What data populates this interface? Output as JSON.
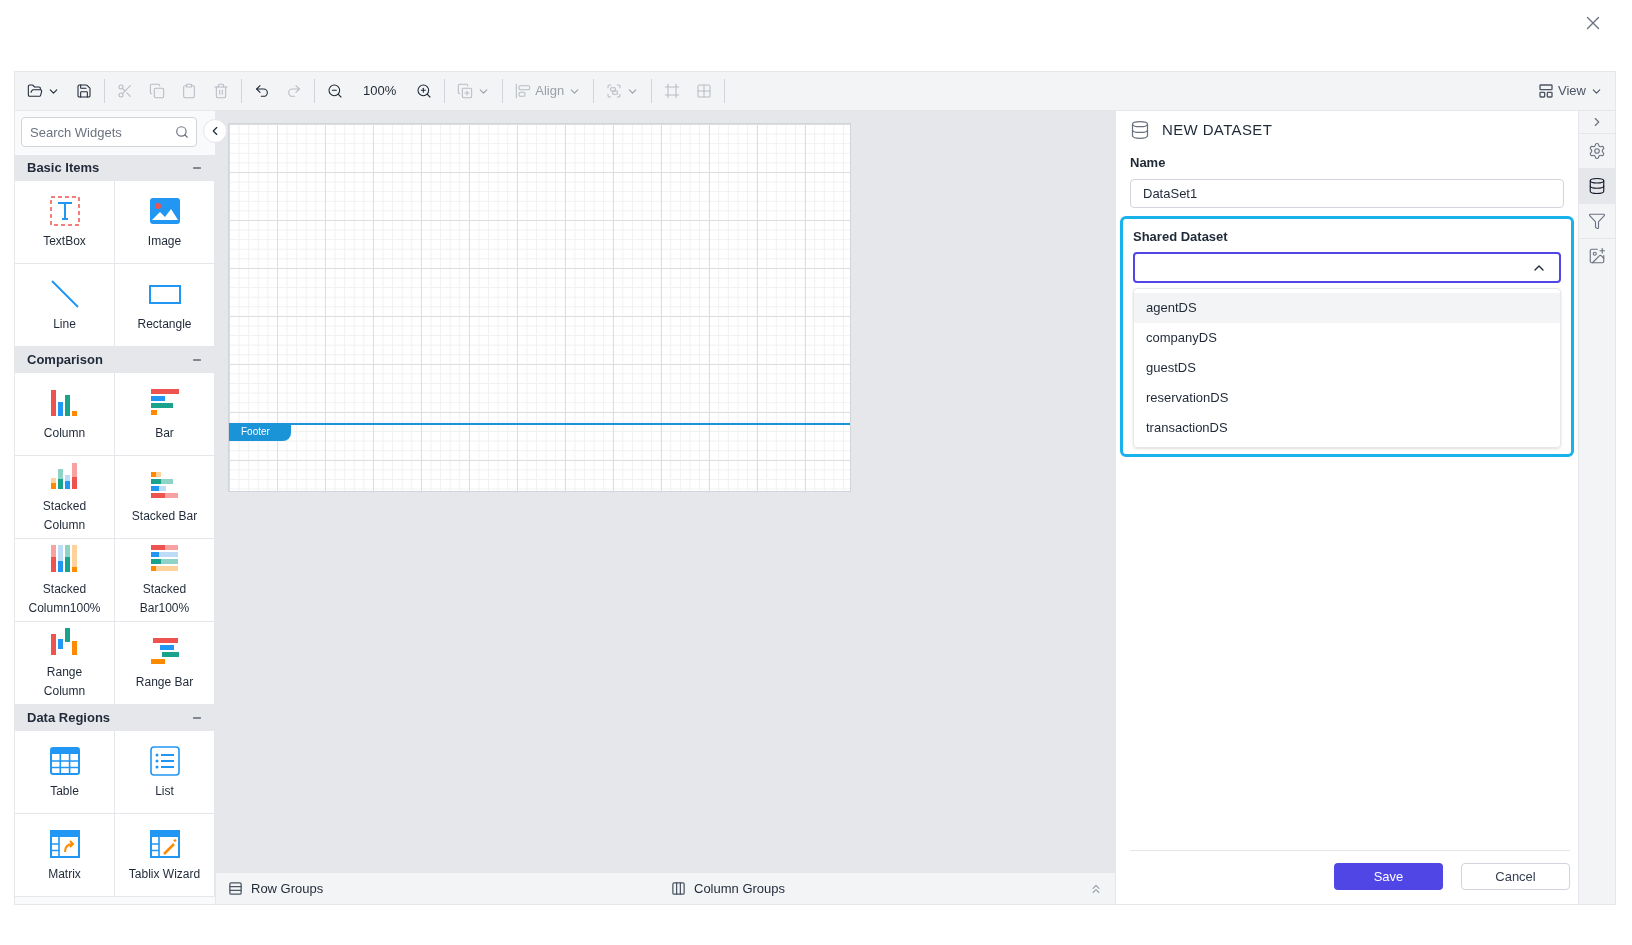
{
  "toolbar": [
    {
      "kind": "open",
      "disabled": false
    },
    {
      "kind": "save",
      "disabled": false
    },
    {
      "kind": "cut",
      "disabled": true
    },
    {
      "kind": "copy",
      "disabled": true
    },
    {
      "kind": "paste",
      "disabled": true
    },
    {
      "kind": "delete",
      "disabled": true
    },
    {
      "kind": "undo",
      "disabled": false
    },
    {
      "kind": "redo",
      "disabled": true
    },
    {
      "kind": "zoom-out",
      "disabled": false
    },
    {
      "kind": "zoom-level",
      "label": "100%",
      "disabled": false
    },
    {
      "kind": "zoom-in",
      "disabled": false
    },
    {
      "kind": "order",
      "disabled": true
    },
    {
      "kind": "align",
      "label": "Align",
      "disabled": true
    },
    {
      "kind": "group",
      "disabled": true
    },
    {
      "kind": "fit",
      "disabled": true
    },
    {
      "kind": "grid",
      "disabled": true
    }
  ],
  "view_menu": {
    "label": "View"
  },
  "search": {
    "placeholder": "Search Widgets"
  },
  "widget_groups": [
    {
      "title": "Basic Items",
      "items": [
        {
          "label": "TextBox",
          "kind": "textbox"
        },
        {
          "label": "Image",
          "kind": "image"
        },
        {
          "label": "Line",
          "kind": "line"
        },
        {
          "label": "Rectangle",
          "kind": "rectangle"
        }
      ]
    },
    {
      "title": "Comparison",
      "items": [
        {
          "label": "Column",
          "kind": "column"
        },
        {
          "label": "Bar",
          "kind": "bar"
        },
        {
          "label": "Stacked Column",
          "kind": "stacked-column"
        },
        {
          "label": "Stacked Bar",
          "kind": "stacked-bar"
        },
        {
          "label": "Stacked Column100%",
          "kind": "stacked-column-100"
        },
        {
          "label": "Stacked Bar100%",
          "kind": "stacked-bar-100"
        },
        {
          "label": "Range Column",
          "kind": "range-column"
        },
        {
          "label": "Range Bar",
          "kind": "range-bar"
        }
      ]
    },
    {
      "title": "Data Regions",
      "items": [
        {
          "label": "Table",
          "kind": "table"
        },
        {
          "label": "List",
          "kind": "list"
        },
        {
          "label": "Matrix",
          "kind": "matrix"
        },
        {
          "label": "Tablix Wizard",
          "kind": "tablix-wizard"
        }
      ]
    }
  ],
  "report": {
    "footer_label": "Footer"
  },
  "group_bar": {
    "row_groups": "Row Groups",
    "column_groups": "Column Groups"
  },
  "panel": {
    "title": "NEW DATASET",
    "name_label": "Name",
    "name_value": "DataSet1",
    "shared_label": "Shared Dataset",
    "dropdown_expanded": true,
    "options": [
      {
        "label": "agentDS",
        "selected": true
      },
      {
        "label": "companyDS",
        "selected": false
      },
      {
        "label": "guestDS",
        "selected": false
      },
      {
        "label": "reservationDS",
        "selected": false
      },
      {
        "label": "transactionDS",
        "selected": false
      }
    ],
    "buttons": [
      {
        "label": "Save",
        "kind": "primary"
      },
      {
        "label": "Cancel",
        "kind": "secondary"
      }
    ]
  },
  "side_tabs": [
    {
      "kind": "properties",
      "selected": false
    },
    {
      "kind": "data",
      "selected": true
    },
    {
      "kind": "filter",
      "selected": false
    },
    {
      "kind": "image-settings",
      "selected": false
    }
  ]
}
